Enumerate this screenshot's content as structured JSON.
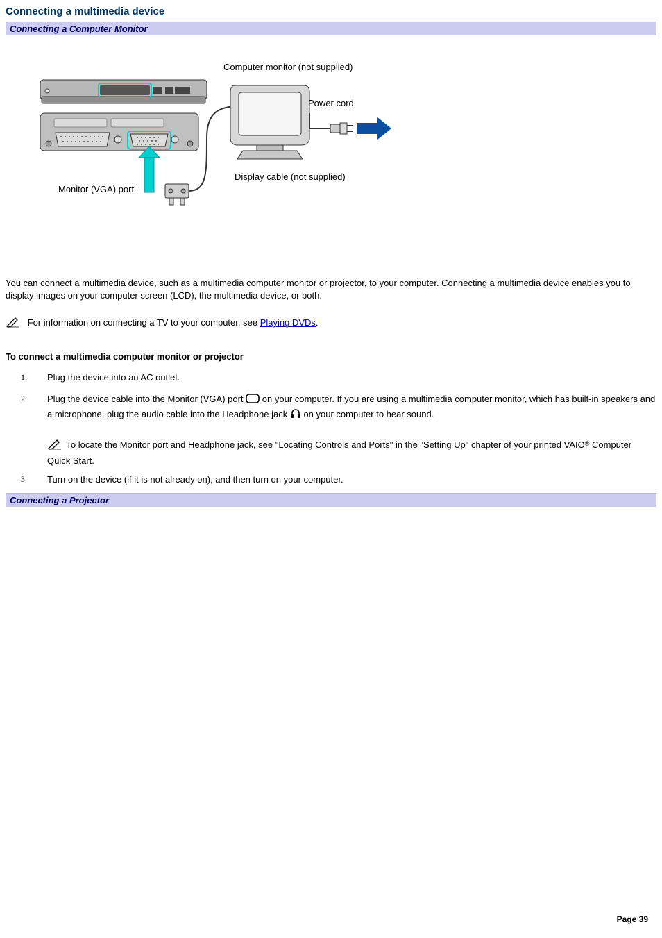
{
  "title": "Connecting a multimedia device",
  "section1": {
    "heading": "Connecting a Computer Monitor"
  },
  "diagram": {
    "monitor_label": "Computer monitor (not supplied)",
    "power_label": "Power cord",
    "display_cable_label": "Display cable (not supplied)",
    "vga_label": "Monitor (VGA) port"
  },
  "para1": "You can connect a multimedia device, such as a multimedia computer monitor or projector, to your computer. Connecting a multimedia device enables you to display images on your computer screen (LCD), the multimedia device, or both.",
  "note1_prefix": "For information on connecting a TV to your computer, see ",
  "note1_link": "Playing DVDs",
  "note1_suffix": ".",
  "sub_heading": "To connect a multimedia computer monitor or projector",
  "steps": {
    "s1": "Plug the device into an AC outlet.",
    "s2a": "Plug the device cable into the Monitor (VGA) port ",
    "s2b": " on your computer. If you are using a multimedia computer monitor, which has built-in speakers and a microphone, plug the audio cable into the Headphone jack ",
    "s2c": " on your computer to hear sound.",
    "s2_note_a": " To locate the Monitor port and Headphone jack, see \"Locating Controls and Ports\" in the \"Setting Up\" chapter of your printed VAIO",
    "s2_note_b": " Computer Quick Start.",
    "s3": "Turn on the device (if it is not already on), and then turn on your computer."
  },
  "section2": {
    "heading": "Connecting a Projector"
  },
  "footer": "Page 39"
}
